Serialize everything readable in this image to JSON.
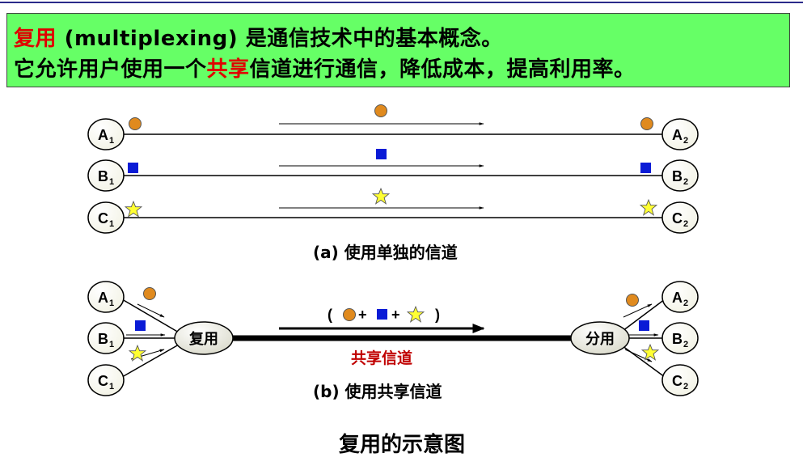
{
  "banner": {
    "line1_red": "复用",
    "line1_rest": " (multiplexing) 是通信技术中的基本概念。",
    "line2_pre": "它允许用户使用一个",
    "line2_red": "共享",
    "line2_post": "信道进行通信，降低成本，提高利用率。"
  },
  "nodes": {
    "a1": "A",
    "a2": "A",
    "b1": "B",
    "b2": "B",
    "c1": "C",
    "c2": "C",
    "sub1": "1",
    "sub2": "2"
  },
  "panel_a": {
    "caption": "(a) 使用单独的信道"
  },
  "panel_b": {
    "caption": "(b) 使用共享信道",
    "mux": "复用",
    "demux": "分用",
    "formula_open": "(",
    "plus": "+",
    "formula_close": ")",
    "channel_label": "共享信道"
  },
  "title": "复用的示意图",
  "colors": {
    "banner_bg": "#66ff66",
    "circle": "#e08a1e",
    "square": "#0a1bd6",
    "star": "#ffff33",
    "accent_red": "#e00000"
  }
}
